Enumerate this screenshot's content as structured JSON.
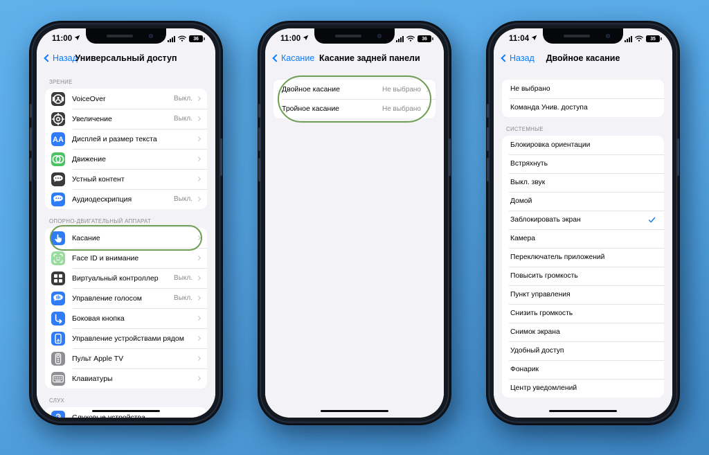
{
  "background_color": "#58A8E6",
  "highlight_color": "#6d9e52",
  "accent_blue": "#0a7cff",
  "phones": [
    {
      "id": "phone-accessibility",
      "status": {
        "time": "11:00",
        "battery": "36",
        "signal_icon": "cellular-signal-icon",
        "wifi_icon": "wifi-icon",
        "location_icon": "location-arrow-icon"
      },
      "nav": {
        "back_label": "Назад",
        "title": "Универсальный доступ",
        "title_centered": true
      },
      "sections": [
        {
          "header": "ЗРЕНИЕ",
          "rows": [
            {
              "label": "VoiceOver",
              "value": "Выкл.",
              "chevron": true,
              "icon": "voiceover-icon",
              "icon_bg": "#3a3a3c"
            },
            {
              "label": "Увеличение",
              "value": "Выкл.",
              "chevron": true,
              "icon": "zoom-icon",
              "icon_bg": "#3a3a3c"
            },
            {
              "label": "Дисплей и размер текста",
              "value": "",
              "chevron": true,
              "icon": "display-text-size-icon",
              "icon_bg": "#2f7cf6"
            },
            {
              "label": "Движение",
              "value": "",
              "chevron": true,
              "icon": "motion-icon",
              "icon_bg": "#4cc464"
            },
            {
              "label": "Устный контент",
              "value": "",
              "chevron": true,
              "icon": "spoken-content-icon",
              "icon_bg": "#3a3a3c"
            },
            {
              "label": "Аудиодескрипция",
              "value": "Выкл.",
              "chevron": true,
              "icon": "audio-descriptions-icon",
              "icon_bg": "#2f7cf6"
            }
          ]
        },
        {
          "header": "ОПОРНО-ДВИГАТЕЛЬНЫЙ АППАРАТ",
          "highlight_first_row": true,
          "rows": [
            {
              "label": "Касание",
              "value": "",
              "chevron": true,
              "icon": "touch-hand-icon",
              "icon_bg": "#2f7cf6"
            },
            {
              "label": "Face ID и внимание",
              "value": "",
              "chevron": true,
              "icon": "face-id-icon",
              "icon_bg": "#9adc9f"
            },
            {
              "label": "Виртуальный контроллер",
              "value": "Выкл.",
              "chevron": true,
              "icon": "switch-control-icon",
              "icon_bg": "#3a3a3c"
            },
            {
              "label": "Управление голосом",
              "value": "Выкл.",
              "chevron": true,
              "icon": "voice-control-icon",
              "icon_bg": "#2f7cf6"
            },
            {
              "label": "Боковая кнопка",
              "value": "",
              "chevron": true,
              "icon": "side-button-icon",
              "icon_bg": "#2f7cf6"
            },
            {
              "label": "Управление устройствами рядом",
              "value": "",
              "chevron": true,
              "icon": "nearby-devices-icon",
              "icon_bg": "#2f7cf6"
            },
            {
              "label": "Пульт Apple TV",
              "value": "",
              "chevron": true,
              "icon": "apple-tv-remote-icon",
              "icon_bg": "#8e8e93"
            },
            {
              "label": "Клавиатуры",
              "value": "",
              "chevron": true,
              "icon": "keyboards-icon",
              "icon_bg": "#8e8e93"
            }
          ]
        },
        {
          "header": "СЛУХ",
          "rows": [
            {
              "label": "Слуховые устройства",
              "value": "",
              "chevron": true,
              "icon": "hearing-devices-icon",
              "icon_bg": "#2f7cf6"
            }
          ]
        }
      ]
    },
    {
      "id": "phone-back-tap",
      "status": {
        "time": "11:00",
        "battery": "36",
        "signal_icon": "cellular-signal-icon",
        "wifi_icon": "wifi-icon",
        "location_icon": "location-arrow-icon"
      },
      "nav": {
        "back_label": "Касание",
        "title": "Касание задней панели",
        "title_centered": false
      },
      "sections": [
        {
          "header": "",
          "highlight_card": true,
          "rows": [
            {
              "label": "Двойное касание",
              "value": "Не выбрано",
              "chevron": true
            },
            {
              "label": "Тройное касание",
              "value": "Не выбрано",
              "chevron": true
            }
          ]
        }
      ]
    },
    {
      "id": "phone-double-tap",
      "status": {
        "time": "11:04",
        "battery": "35",
        "signal_icon": "cellular-signal-icon",
        "wifi_icon": "wifi-icon",
        "location_icon": "location-arrow-icon"
      },
      "nav": {
        "back_label": "Назад",
        "title": "Двойное касание",
        "title_centered": true
      },
      "sections": [
        {
          "header": "",
          "rows": [
            {
              "label": "Не выбрано",
              "checked": false
            },
            {
              "label": "Команда Унив. доступа",
              "checked": false
            }
          ]
        },
        {
          "header": "СИСТЕМНЫЕ",
          "rows": [
            {
              "label": "Блокировка ориентации",
              "checked": false
            },
            {
              "label": "Встряхнуть",
              "checked": false
            },
            {
              "label": "Выкл. звук",
              "checked": false
            },
            {
              "label": "Домой",
              "checked": false
            },
            {
              "label": "Заблокировать экран",
              "checked": true
            },
            {
              "label": "Камера",
              "checked": false
            },
            {
              "label": "Переключатель приложений",
              "checked": false
            },
            {
              "label": "Повысить громкость",
              "checked": false
            },
            {
              "label": "Пункт управления",
              "checked": false
            },
            {
              "label": "Снизить громкость",
              "checked": false
            },
            {
              "label": "Снимок экрана",
              "checked": false
            },
            {
              "label": "Удобный доступ",
              "checked": false
            },
            {
              "label": "Фонарик",
              "checked": false
            },
            {
              "label": "Центр уведомлений",
              "checked": false
            }
          ]
        }
      ]
    }
  ]
}
